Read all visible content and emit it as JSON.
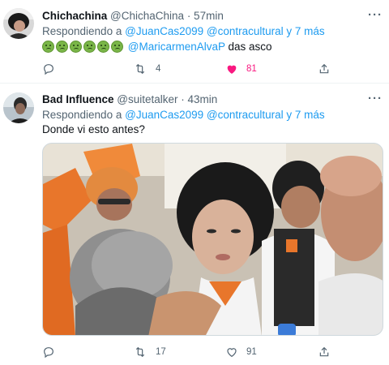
{
  "tweets": [
    {
      "name": "Chichachina",
      "handle": "@ChichaChina",
      "time": "· 57min",
      "more": "···",
      "reply_prefix": "Respondiendo a",
      "reply_user": "@JuanCas2099",
      "reply_user2": "@contracultural",
      "reply_suffix": "y 7 más",
      "body_mention": "@MaricarmenAlvaP",
      "body_text": "das asco",
      "emoji_count": 6,
      "emoji_name": "nauseated-face-emoji",
      "actions": {
        "comments": "",
        "retweets": "4",
        "likes": "81",
        "liked": true
      }
    },
    {
      "name": "Bad Influence",
      "handle": "@suitetalker",
      "time": "· 43min",
      "more": "···",
      "reply_prefix": "Respondiendo a",
      "reply_user": "@JuanCas2099",
      "reply_user2": "@contracultural",
      "reply_suffix": "y 7 más",
      "body_text": "Donde vi esto antes?",
      "actions": {
        "comments": "",
        "retweets": "17",
        "likes": "91",
        "liked": false
      }
    }
  ],
  "colors": {
    "accent": "#1d9bf0",
    "like": "#f91880",
    "muted": "#536471",
    "text": "#0f1419"
  },
  "icons": [
    "reply-icon",
    "retweet-icon",
    "like-icon",
    "share-icon"
  ]
}
